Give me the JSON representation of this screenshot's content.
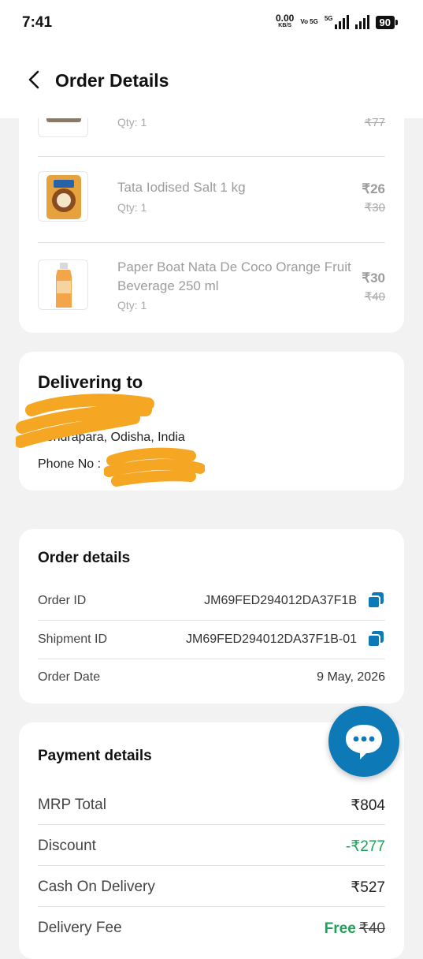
{
  "status_bar": {
    "time": "7:41",
    "net_speed": "0.00",
    "net_unit": "KB/S",
    "volte": "Vo 5G",
    "network": "5G",
    "battery": "90"
  },
  "header": {
    "title": "Order Details"
  },
  "items": [
    {
      "name": "",
      "qty": "Qty: 1",
      "price": "",
      "mrp": "₹77"
    },
    {
      "name": "Tata Iodised Salt 1 kg",
      "qty": "Qty: 1",
      "price": "₹26",
      "mrp": "₹30"
    },
    {
      "name": "Paper Boat Nata De Coco Orange Fruit Beverage 250 ml",
      "qty": "Qty: 1",
      "price": "₹30",
      "mrp": "₹40"
    }
  ],
  "delivery": {
    "title": "Delivering to",
    "address": "Kendrapara, Odisha, India",
    "phone_label": "Phone No :"
  },
  "order_details": {
    "title": "Order details",
    "order_id_label": "Order ID",
    "order_id": "JM69FED294012DA37F1B",
    "shipment_id_label": "Shipment ID",
    "shipment_id": "JM69FED294012DA37F1B-01",
    "order_date_label": "Order Date",
    "order_date": "9 May, 2026"
  },
  "payment": {
    "title": "Payment details",
    "mrp_total_label": "MRP Total",
    "mrp_total": "₹804",
    "discount_label": "Discount",
    "discount": "-₹277",
    "cod_label": "Cash On Delivery",
    "cod": "₹527",
    "delivery_fee_label": "Delivery Fee",
    "delivery_fee": "Free",
    "delivery_fee_original": "₹40"
  },
  "colors": {
    "accent": "#0d79b7",
    "green": "#1ea15a",
    "redaction": "#f5a623"
  },
  "icons": {
    "back": "chevron-left-icon",
    "copy": "copy-icon",
    "chat": "chat-bubble-icon"
  }
}
